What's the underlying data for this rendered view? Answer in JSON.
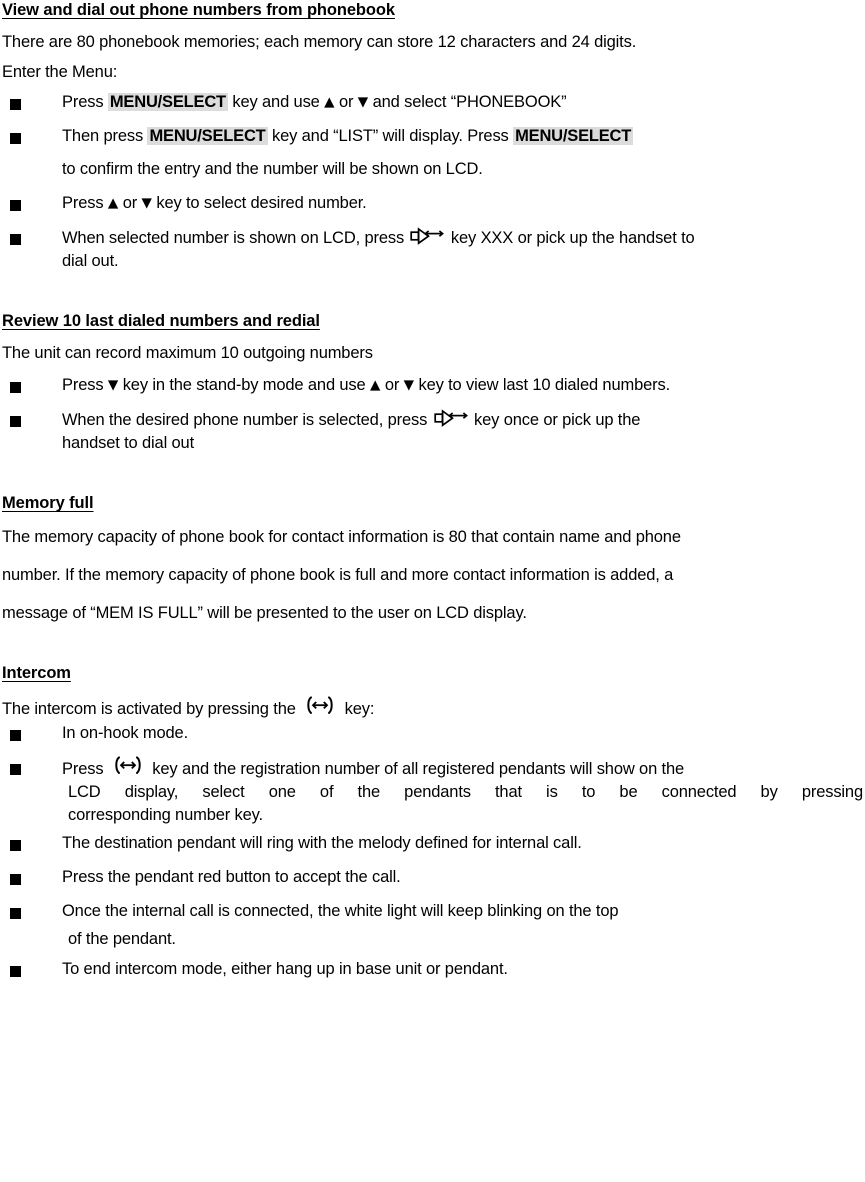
{
  "document": {
    "type": "user-manual-page",
    "sections": [
      {
        "id": "phonebook",
        "heading": "View and dial out phone numbers from phonebook",
        "intro": [
          "There are 80 phonebook memories; each memory can store 12 characters and 24 digits.",
          "Enter the Menu:"
        ],
        "bullets": [
          {
            "id": "pb-1",
            "segments": [
              {
                "text": "Press "
              },
              {
                "text": "MENU/SELECT",
                "style": "key-label"
              },
              {
                "text": " key and use "
              },
              {
                "text": "▲",
                "style": "arrow"
              },
              {
                "text": " or "
              },
              {
                "text": "▼",
                "style": "arrow"
              },
              {
                "text": " and select “PHONEBOOK”"
              }
            ]
          },
          {
            "id": "pb-2",
            "segments": [
              {
                "text": "Then press "
              },
              {
                "text": "MENU/SELECT",
                "style": "key-label"
              },
              {
                "text": " key and “LIST” will display. Press "
              },
              {
                "text": "MENU/SELECT",
                "style": "key-label"
              }
            ],
            "continuation": "to confirm the entry and the number will be shown on LCD."
          },
          {
            "id": "pb-3",
            "segments": [
              {
                "text": "Press "
              },
              {
                "text": "▲",
                "style": "arrow"
              },
              {
                "text": " or "
              },
              {
                "text": "▼",
                "style": "arrow"
              },
              {
                "text": " key to select desired number."
              }
            ]
          },
          {
            "id": "pb-4",
            "segments": [
              {
                "text": "When selected number is shown on LCD, press "
              },
              {
                "icon": "speakerphone-icon"
              },
              {
                "text": " key XXX or pick up the handset to"
              }
            ],
            "continuation": "dial out."
          }
        ]
      },
      {
        "id": "redial",
        "heading": "Review 10 last dialed numbers and redial",
        "intro": [
          "The unit can record maximum 10 outgoing numbers"
        ],
        "bullets": [
          {
            "id": "rd-1",
            "segments": [
              {
                "text": "Press "
              },
              {
                "text": "▼",
                "style": "arrow"
              },
              {
                "text": " key in the stand-by mode and use "
              },
              {
                "text": "▲",
                "style": "arrow"
              },
              {
                "text": " or "
              },
              {
                "text": "▼",
                "style": "arrow"
              },
              {
                "text": " key to view last 10 dialed numbers."
              }
            ]
          },
          {
            "id": "rd-2",
            "segments": [
              {
                "text": "When the desired phone number is selected, press "
              },
              {
                "icon": "speakerphone-icon"
              },
              {
                "text": " key once or pick up the"
              }
            ],
            "continuation": "handset to dial out"
          }
        ]
      },
      {
        "id": "memory-full",
        "heading": "Memory full",
        "paragraph": [
          "The memory capacity of phone book for contact information is 80 that contain name and phone",
          "number. If the memory capacity of phone book is full and more contact information is added, a",
          "message of “MEM IS FULL” will be presented to the user on LCD display."
        ]
      },
      {
        "id": "intercom",
        "heading": "Intercom",
        "intro_segments": [
          {
            "text": "The intercom is activated by pressing the "
          },
          {
            "icon": "intercom-icon"
          },
          {
            "text": " key:"
          }
        ],
        "bullets": [
          {
            "id": "ic-1",
            "segments": [
              {
                "text": "In on-hook mode."
              }
            ]
          },
          {
            "id": "ic-2",
            "segments": [
              {
                "text": "Press "
              },
              {
                "icon": "intercom-icon"
              },
              {
                "text": " key and the registration number of all registered pendants will show on the"
              }
            ],
            "continuation_justified": "LCD display, select one of the pendants that is to be connected by pressing",
            "continuation2": "corresponding number key."
          },
          {
            "id": "ic-3",
            "segments": [
              {
                "text": "The destination pendant will ring with the melody defined for internal call."
              }
            ]
          },
          {
            "id": "ic-4",
            "segments": [
              {
                "text": "Press the pendant red button to accept the call."
              }
            ]
          },
          {
            "id": "ic-5",
            "segments": [
              {
                "text": "Once the internal call is connected, the white light will keep blinking on the top"
              }
            ],
            "continuation": "of the pendant."
          },
          {
            "id": "ic-6",
            "segments": [
              {
                "text": "To end intercom mode, either hang up in base unit or pendant."
              }
            ]
          }
        ]
      }
    ]
  },
  "text": {
    "s1_heading": "View and dial out phone numbers from phonebook",
    "s1_p1": "There are 80 phonebook memories; each memory can store 12 characters and 24 digits.",
    "s1_p2": "Enter the Menu:",
    "s1_b1_a": "Press ",
    "s1_b1_key": "MENU/SELECT",
    "s1_b1_b": " key and use ",
    "s1_b1_up": "▲",
    "s1_b1_c": " or ",
    "s1_b1_down": "▼",
    "s1_b1_d": " and select “PHONEBOOK”",
    "s1_b2_a": "Then press ",
    "s1_b2_key1": "MENU/SELECT",
    "s1_b2_b": " key and “LIST” will display. Press ",
    "s1_b2_key2": "MENU/SELECT",
    "s1_b2_cont": "to confirm the entry and the number will be shown on LCD.",
    "s1_b3_a": "Press ",
    "s1_b3_up": "▲",
    "s1_b3_b": " or ",
    "s1_b3_down": "▼",
    "s1_b3_c": " key to select desired number.",
    "s1_b4_a": "When selected number is shown on LCD, press ",
    "s1_b4_b": " key XXX or pick up the handset to",
    "s1_b4_cont": "dial out.",
    "s2_heading": "Review 10 last dialed numbers and redial",
    "s2_p1": "The unit can record maximum 10 outgoing numbers",
    "s2_b1_a": "Press ",
    "s2_b1_down1": "▼",
    "s2_b1_b": " key in the stand-by mode and use ",
    "s2_b1_up": "▲",
    "s2_b1_c": " or ",
    "s2_b1_down2": "▼",
    "s2_b1_d": " key to view last 10 dialed numbers.",
    "s2_b2_a": "When the desired phone number is selected, press ",
    "s2_b2_b": " key once or pick up the",
    "s2_b2_cont": "handset to dial out",
    "s3_heading": "Memory full",
    "s3_l1": "The memory capacity of phone book for contact information is 80 that contain name and phone",
    "s3_l2": "number. If the memory capacity of phone book is full and more contact information is added, a",
    "s3_l3": "message of “MEM IS FULL” will be presented to the user on LCD display.",
    "s4_heading": "Intercom",
    "s4_p1_a": "The intercom is activated by pressing the ",
    "s4_p1_b": " key:",
    "s4_b1": "In on-hook mode.",
    "s4_b2_a": "Press ",
    "s4_b2_b": " key and the registration number of all registered pendants will show on the",
    "s4_b2_cont1": "LCD display, select one of the pendants that is to be connected by pressing",
    "s4_b2_cont2": "corresponding number key.",
    "s4_b3": "The destination pendant will ring with the melody defined for internal call.",
    "s4_b4": "Press the pendant red button to accept the call.",
    "s4_b5": "Once the internal call is connected, the white light will keep blinking on the top",
    "s4_b5_cont": "of the pendant.",
    "s4_b6": "To end intercom mode, either hang up in base unit or pendant."
  },
  "icons": {
    "speakerphone": "speakerphone-icon",
    "intercom": "intercom-icon",
    "bullet": "square-bullet-icon",
    "arrow_up": "arrow-up-icon",
    "arrow_down": "arrow-down-icon"
  },
  "colors": {
    "text": "#000000",
    "page_background": "#ffffff",
    "key_highlight": "#dcdcdc"
  }
}
